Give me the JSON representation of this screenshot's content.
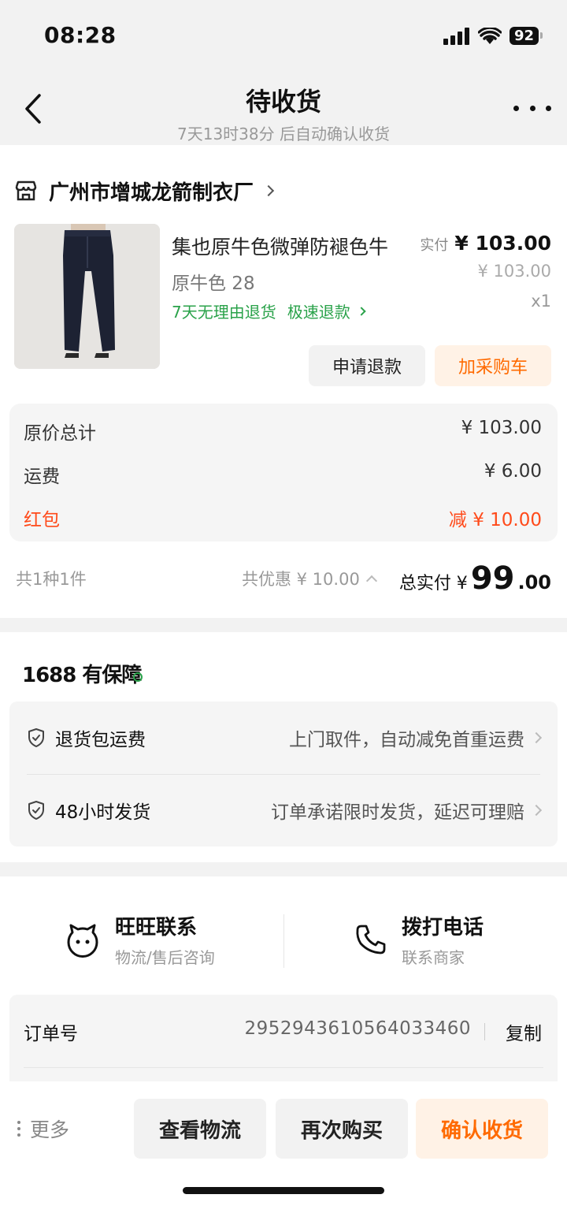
{
  "status_bar": {
    "time": "08:28",
    "battery": "92"
  },
  "nav": {
    "title": "待收货",
    "subtitle": "7天13时38分 后自动确认收货"
  },
  "store": {
    "name": "广州市增城龙箭制衣厂"
  },
  "product": {
    "title": "集也原牛色微弹防褪色牛",
    "spec": "原牛色 28",
    "tag_return": "7天无理由退货",
    "tag_refund": "极速退款",
    "paid_label": "实付",
    "paid_price": "¥ 103.00",
    "original_price": "¥ 103.00",
    "quantity": "x1",
    "refund_button": "申请退款",
    "cart_button": "加采购车"
  },
  "summary": {
    "original_total_label": "原价总计",
    "original_total_value": "¥ 103.00",
    "shipping_label": "运费",
    "shipping_value": "¥ 6.00",
    "redpacket_label": "红包",
    "redpacket_value": "减 ¥ 10.00"
  },
  "total": {
    "count": "共1种1件",
    "discount": "共优惠 ¥ 10.00",
    "final_label": "总实付 ¥",
    "final_integer": "99",
    "final_cents": ".00"
  },
  "guarantee": {
    "title": "1688 有保障",
    "items": [
      {
        "label": "退货包运费",
        "desc": "上门取件，自动减免首重运费"
      },
      {
        "label": "48小时发货",
        "desc": "订单承诺限时发货，延迟可理赔"
      }
    ]
  },
  "contact": {
    "wangwang_title": "旺旺联系",
    "wangwang_sub": "物流/售后咨询",
    "phone_title": "拨打电话",
    "phone_sub": "联系商家"
  },
  "order": {
    "label": "订单号",
    "number": "2952943610564033460",
    "copy": "复制"
  },
  "bottom_bar": {
    "more": "更多",
    "logistics": "查看物流",
    "rebuy": "再次购买",
    "confirm": "确认收货"
  },
  "colors": {
    "accent_orange": "#ff6a00",
    "green": "#2aa24a",
    "red": "#ff4a1a"
  }
}
